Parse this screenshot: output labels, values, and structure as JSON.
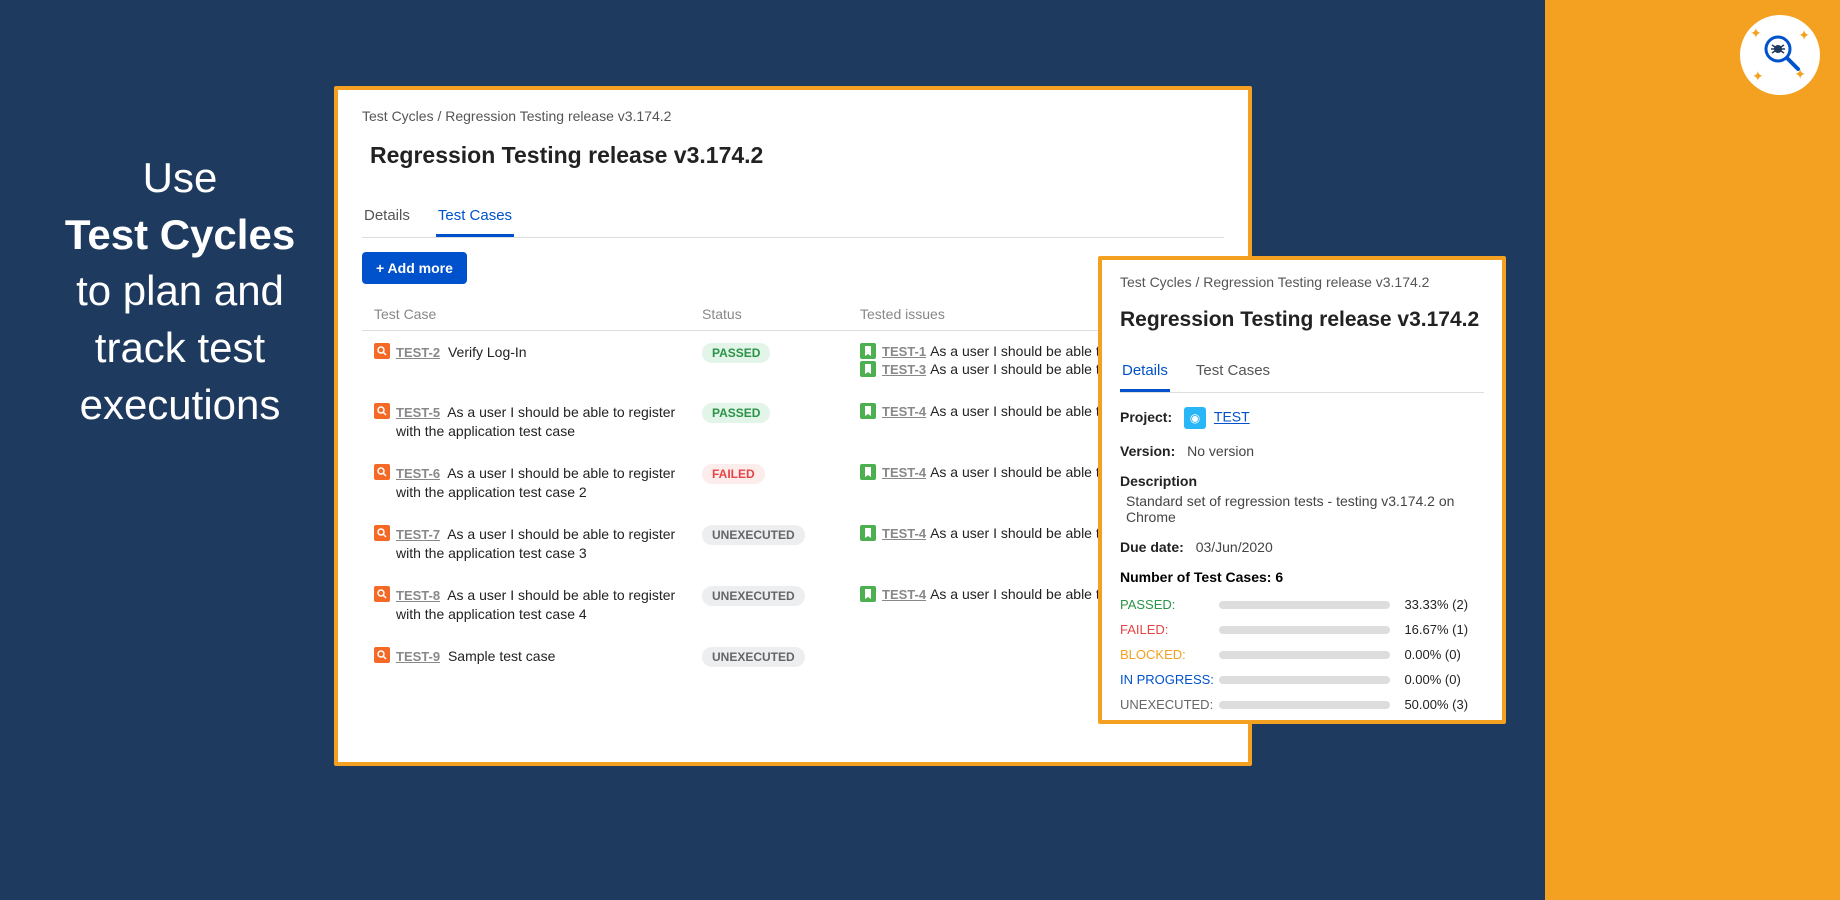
{
  "promo": {
    "line1": "Use",
    "line2": "Test Cycles",
    "line3": "to plan and track test executions"
  },
  "main": {
    "breadcrumb": {
      "root": "Test Cycles",
      "current": "Regression Testing release v3.174.2"
    },
    "title": "Regression Testing release v3.174.2",
    "tabs": [
      {
        "label": "Details",
        "active": false
      },
      {
        "label": "Test Cases",
        "active": true
      }
    ],
    "add_button": "+ Add more",
    "columns": {
      "tc": "Test Case",
      "status": "Status",
      "issues": "Tested issues"
    },
    "rows": [
      {
        "key": "TEST-2",
        "title": "Verify Log-In",
        "status": "PASSED",
        "issues": [
          {
            "key": "TEST-1",
            "summary": "As a user I should be able to log i"
          },
          {
            "key": "TEST-3",
            "summary": "As a user I should be able to log i"
          }
        ]
      },
      {
        "key": "TEST-5",
        "title": "As a user I should be able to register with the application test case",
        "status": "PASSED",
        "issues": [
          {
            "key": "TEST-4",
            "summary": "As a user I should be able to regis"
          }
        ]
      },
      {
        "key": "TEST-6",
        "title": "As a user I should be able to register with the application test case 2",
        "status": "FAILED",
        "issues": [
          {
            "key": "TEST-4",
            "summary": "As a user I should be able to regis"
          }
        ]
      },
      {
        "key": "TEST-7",
        "title": "As a user I should be able to register with the application test case 3",
        "status": "UNEXECUTED",
        "issues": [
          {
            "key": "TEST-4",
            "summary": "As a user I should be able to regis"
          }
        ]
      },
      {
        "key": "TEST-8",
        "title": "As a user I should be able to register with the application test case 4",
        "status": "UNEXECUTED",
        "issues": [
          {
            "key": "TEST-4",
            "summary": "As a user I should be able to regis"
          }
        ]
      },
      {
        "key": "TEST-9",
        "title": "Sample test case",
        "status": "UNEXECUTED",
        "issues": []
      }
    ]
  },
  "detail": {
    "breadcrumb": {
      "root": "Test Cycles",
      "current": "Regression Testing release v3.174.2"
    },
    "title": "Regression Testing release v3.174.2",
    "tabs": [
      {
        "label": "Details",
        "active": true
      },
      {
        "label": "Test Cases",
        "active": false
      }
    ],
    "project_label": "Project:",
    "project_value": "TEST",
    "version_label": "Version:",
    "version_value": "No version",
    "description_label": "Description",
    "description_value": "Standard set of regression tests - testing v3.174.2 on Chrome",
    "due_label": "Due date:",
    "due_value": "03/Jun/2020",
    "count_label": "Number of Test Cases: 6",
    "stats": [
      {
        "key": "PASSED:",
        "class": "passed",
        "pct": 33.33,
        "text": "33.33% (2)"
      },
      {
        "key": "FAILED:",
        "class": "failed",
        "pct": 16.67,
        "text": "16.67% (1)"
      },
      {
        "key": "BLOCKED:",
        "class": "blocked",
        "pct": 0,
        "text": "0.00% (0)"
      },
      {
        "key": "IN PROGRESS:",
        "class": "inprogress",
        "pct": 0,
        "text": "0.00% (0)"
      },
      {
        "key": "UNEXECUTED:",
        "class": "unexecuted",
        "pct": 50,
        "text": "50.00% (3)"
      }
    ]
  }
}
